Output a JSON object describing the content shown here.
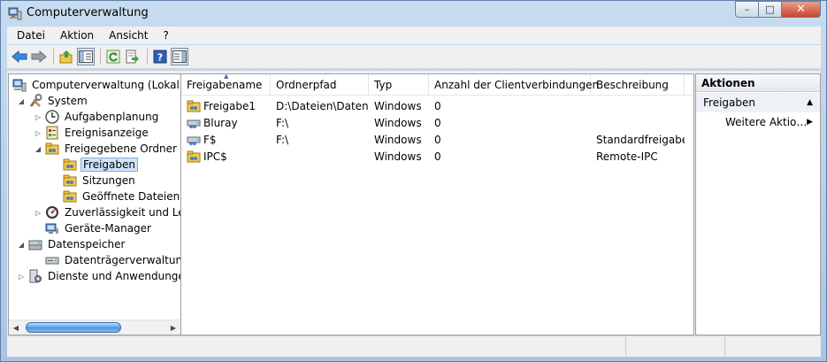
{
  "window": {
    "title": "Computerverwaltung",
    "icon": "computer-management-icon",
    "controls": {
      "minimize": "–",
      "maximize": "□",
      "close": "✕"
    }
  },
  "menu": {
    "items": [
      "Datei",
      "Aktion",
      "Ansicht",
      "?"
    ]
  },
  "toolbar": {
    "buttons": [
      "back-arrow-icon",
      "forward-arrow-icon",
      "up-folder-icon",
      "show-hide-tree-icon",
      "refresh-icon",
      "export-list-icon",
      "help-icon",
      "show-hide-action-pane-icon"
    ]
  },
  "tree": {
    "items": [
      {
        "label": "Computerverwaltung (Lokal)",
        "icon": "computer-management-icon",
        "expander": ""
      },
      {
        "label": "System",
        "icon": "tools-icon",
        "expander": "◢"
      },
      {
        "label": "Aufgabenplanung",
        "icon": "clock-icon",
        "expander": "▷"
      },
      {
        "label": "Ereignisanzeige",
        "icon": "event-viewer-icon",
        "expander": "▷"
      },
      {
        "label": "Freigegebene Ordner",
        "icon": "shared-folder-icon",
        "expander": "◢"
      },
      {
        "label": "Freigaben",
        "icon": "shared-folder-icon",
        "expander": ""
      },
      {
        "label": "Sitzungen",
        "icon": "shared-folder-icon",
        "expander": ""
      },
      {
        "label": "Geöffnete Dateien",
        "icon": "shared-folder-icon",
        "expander": ""
      },
      {
        "label": "Zuverlässigkeit und Leis",
        "icon": "performance-icon",
        "expander": "▷"
      },
      {
        "label": "Geräte-Manager",
        "icon": "device-manager-icon",
        "expander": ""
      },
      {
        "label": "Datenspeicher",
        "icon": "storage-icon",
        "expander": "◢"
      },
      {
        "label": "Datenträgerverwaltung",
        "icon": "disk-management-icon",
        "expander": ""
      },
      {
        "label": "Dienste und Anwendungen",
        "icon": "services-icon",
        "expander": "▷"
      }
    ]
  },
  "list": {
    "columns": [
      "Freigabename",
      "Ordnerpfad",
      "Typ",
      "Anzahl der Clientverbindungen",
      "Beschreibung"
    ],
    "rows": [
      {
        "name": "Freigabe1",
        "path": "D:\\Dateien\\Daten",
        "type": "Windows",
        "connections": "0",
        "description": "",
        "icon": "shared-folder-icon"
      },
      {
        "name": "Bluray",
        "path": "F:\\",
        "type": "Windows",
        "connections": "0",
        "description": "",
        "icon": "shared-drive-icon"
      },
      {
        "name": "F$",
        "path": "F:\\",
        "type": "Windows",
        "connections": "0",
        "description": "Standardfreigabe",
        "icon": "shared-drive-icon"
      },
      {
        "name": "IPC$",
        "path": "",
        "type": "Windows",
        "connections": "0",
        "description": "Remote-IPC",
        "icon": "shared-folder-icon"
      }
    ]
  },
  "actions": {
    "title": "Aktionen",
    "section": "Freigaben",
    "section_caret": "▲",
    "more": "Weitere Aktio…",
    "more_caret": "▶"
  },
  "colors": {
    "accent": "#3a6fb0",
    "selection": "#cfe3f9"
  }
}
